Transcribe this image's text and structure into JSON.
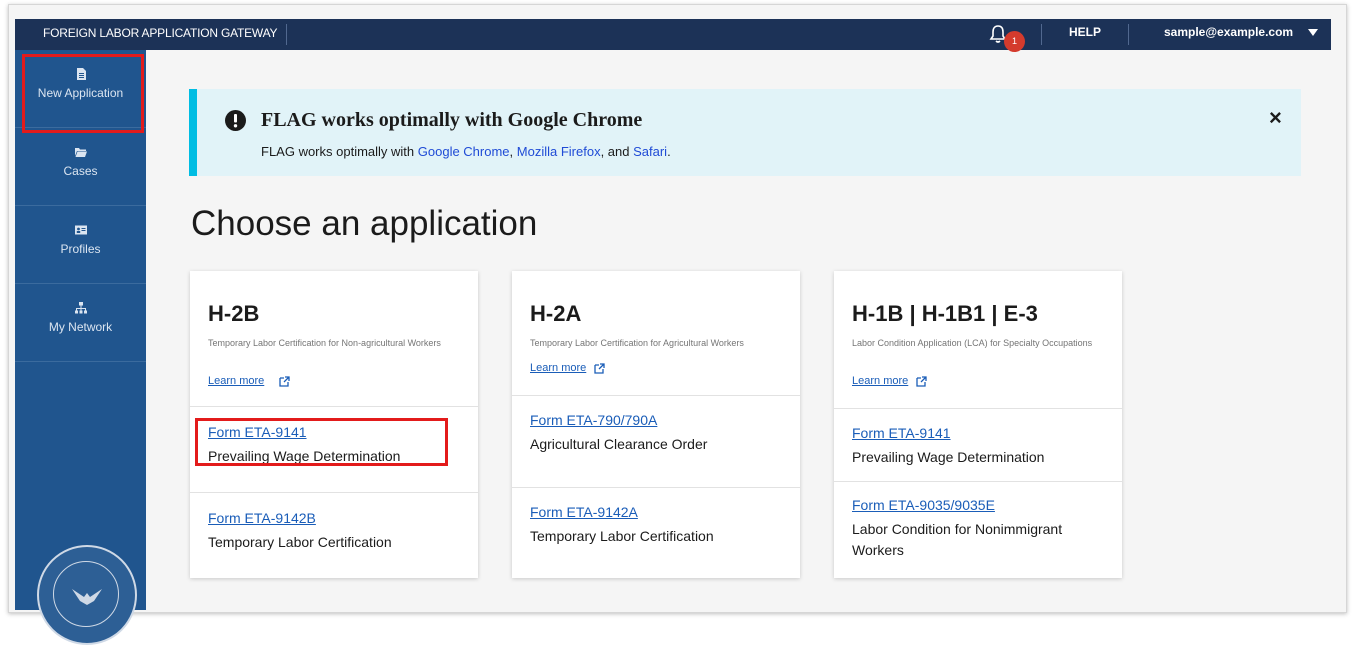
{
  "topbar": {
    "app_title": "FOREIGN LABOR APPLICATION GATEWAY",
    "notification_count": "1",
    "help_label": "HELP",
    "user_email": "sample@example.com"
  },
  "sidebar": {
    "items": [
      {
        "label": "New Application",
        "icon": "file-icon"
      },
      {
        "label": "Cases",
        "icon": "folder-icon"
      },
      {
        "label": "Profiles",
        "icon": "id-card-icon"
      },
      {
        "label": "My Network",
        "icon": "network-icon"
      }
    ]
  },
  "banner": {
    "heading": "FLAG works optimally with Google Chrome",
    "text_prefix": "FLAG works optimally with ",
    "link_chrome": "Google Chrome",
    "sep1": ", ",
    "link_firefox": "Mozilla Firefox",
    "sep2": ", and ",
    "link_safari": "Safari",
    "suffix": ".",
    "close_label": "×"
  },
  "page": {
    "title": "Choose an application"
  },
  "cards": [
    {
      "title": "H-2B",
      "description": "Temporary Labor Certification for Non-agricultural Workers",
      "learn_more": "Learn more",
      "forms": [
        {
          "code": "Form ETA-9141",
          "name": "Prevailing Wage Determination"
        },
        {
          "code": "Form ETA-9142B",
          "name": "Temporary Labor Certification"
        }
      ]
    },
    {
      "title": "H-2A",
      "description": "Temporary Labor Certification for Agricultural Workers",
      "learn_more": "Learn more",
      "forms": [
        {
          "code": "Form ETA-790/790A",
          "name": "Agricultural Clearance Order"
        },
        {
          "code": "Form ETA-9142A",
          "name": "Temporary Labor Certification"
        }
      ]
    },
    {
      "title": "H-1B | H-1B1 | E-3",
      "description": "Labor Condition Application (LCA) for Specialty Occupations",
      "learn_more": "Learn more",
      "forms": [
        {
          "code": "Form ETA-9141",
          "name": "Prevailing Wage Determination"
        },
        {
          "code": "Form ETA-9035/9035E",
          "name": "Labor Condition for Nonimmigrant Workers"
        }
      ]
    }
  ],
  "colors": {
    "topbar": "#1c3257",
    "sidebar": "#20558e",
    "banner_bg": "#e1f3f8",
    "banner_accent": "#00bde3",
    "link": "#1a5db8",
    "highlight": "#e31b1b"
  }
}
